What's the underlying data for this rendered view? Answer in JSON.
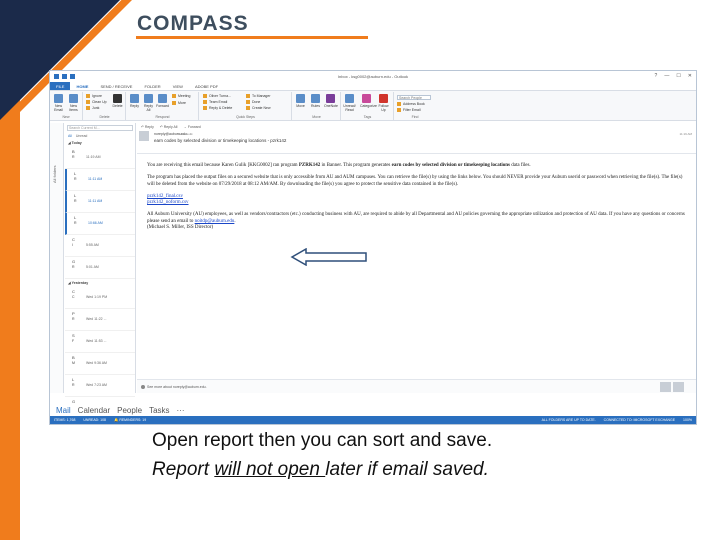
{
  "slide": {
    "logo_text": "COMPASS",
    "caption_line1": "Open report then you can sort and save.",
    "caption_line2_pre": "Report ",
    "caption_line2_underlined": "will not open ",
    "caption_line2_post": "later if email saved.",
    "colors": {
      "accent": "#f07c1c",
      "navy": "#1b2a4a",
      "outlook_blue": "#2a6fbf"
    }
  },
  "window": {
    "title": "Inbox - ksg0002@auburn.edu - Outlook",
    "controls": [
      "?",
      "—",
      "☐",
      "✕"
    ],
    "tabs": [
      "FILE",
      "HOME",
      "SEND / RECEIVE",
      "FOLDER",
      "VIEW",
      "ADOBE PDF"
    ],
    "active_tab": "HOME"
  },
  "ribbon": {
    "new": {
      "new_email": "New Email",
      "new_items": "New Items",
      "label": "New"
    },
    "delete": {
      "ignore": "Ignore",
      "clean_up": "Clean Up",
      "junk": "Junk",
      "delete": "Delete",
      "label": "Delete"
    },
    "respond": {
      "reply": "Reply",
      "reply_all": "Reply All",
      "forward": "Forward",
      "meeting": "Meeting",
      "more": "More",
      "label": "Respond"
    },
    "quick_steps": {
      "s1": "Oliver Turna...",
      "s2": "Team Email",
      "s3": "Reply & Delete",
      "s4": "To Manager",
      "s5": "Done",
      "s6": "Create New",
      "label": "Quick Steps"
    },
    "move": {
      "move": "Move",
      "rules": "Rules",
      "onenote": "OneNote",
      "label": "Move"
    },
    "tags": {
      "unread_read": "Unread/ Read",
      "categorize": "Categorize",
      "follow_up": "Follow Up",
      "label": "Tags"
    },
    "find": {
      "search_people": "Search People",
      "address_book": "Address Book",
      "filter_email": "Filter Email",
      "label": "Find"
    }
  },
  "sidebar": {
    "label": "All folders"
  },
  "message_list": {
    "search_placeholder": "Search Current M...",
    "filter_all": "All",
    "filter_unread": "Unread",
    "sort": "By Date",
    "today_label": "◢ Today",
    "yesterday_label": "◢ Yesterday",
    "today": [
      {
        "from": "B",
        "subj": "R",
        "time": "11:19 AM",
        "unread": false
      },
      {
        "from": "L",
        "subj": "R",
        "time": "11:11 AM",
        "unread": true
      },
      {
        "from": "L",
        "subj": "R",
        "time": "11:11 AM",
        "unread": true
      },
      {
        "from": "L",
        "subj": "R",
        "time": "10:66 AM",
        "unread": true
      },
      {
        "from": "C",
        "subj": "I",
        "time": "5:55 AM",
        "unread": false
      },
      {
        "from": "G",
        "subj": "R",
        "time": "5:01 AM",
        "unread": false
      }
    ],
    "yesterday": [
      {
        "from": "C",
        "subj": "C",
        "time": "Wed 1:19 PM"
      },
      {
        "from": "P",
        "subj": "R",
        "time": "Wed 11:22 ..."
      },
      {
        "from": "S",
        "subj": "F",
        "time": "Wed 11:53 ..."
      },
      {
        "from": "B",
        "subj": "M",
        "time": "Wed 9:36 AM"
      },
      {
        "from": "L",
        "subj": "R",
        "time": "Wed 7:23 AM"
      },
      {
        "from": "G",
        "subj": "R",
        "time": "Wed 5:01 AM"
      }
    ]
  },
  "reading": {
    "toolbar": [
      "↶ Reply",
      "↶ Reply All",
      "→ Forward"
    ],
    "from": "noreply@auburn.edu",
    "to": "Karen Gulik",
    "subject": "earn codes by selected division or timekeeping locations - pzrk142",
    "time": "11:19 AM",
    "para1_pre": "You are receiving this email because Karen Gulik [KKG0002] ran program ",
    "para1_prog": "PZRK142",
    "para1_mid": " in Banner. This program generates ",
    "para1_bold": "earn codes by selected division or timekeeping locations",
    "para1_post": " data files.",
    "para2": "The program has placed the output files on a secured website that is only accessible from AU and AUM campuses. You can retrieve the file(s) by using the links below. You should NEVER provide your Auburn userid or password when retrieving the file(s). The file(s) will be deleted from the website on 07/29/2018 at 08:12 AM/AM. By downloading the file(s) you agree to protect the sensitive data contained in the file(s).",
    "link1": "pzrk142_final.csv",
    "link2": "pzrk142_noform.csv",
    "para3_pre": "All Auburn University (AU) employees, as well as vendors/contractors (etc.) conducting business with AU, are required to abide by all Departmental and AU policies governing the appropriate utilization and protection of AU data. If you have any questions or concerns please send an email to ",
    "para3_link": "noitdp@auburn.edu",
    "para3_post": ".",
    "signature": "(Michael S. Miller, ISS Director)",
    "people_info": "See more about noreply@auburn.edu."
  },
  "navbar": {
    "mail": "Mail",
    "calendar": "Calendar",
    "people": "People",
    "tasks": "Tasks",
    "more": "···"
  },
  "statusbar": {
    "items": "ITEMS: 1,768",
    "unread": "UNREAD: 108",
    "reminders": "🔔 REMINDERS: 19",
    "folders": "ALL FOLDERS ARE UP TO DATE.",
    "connected": "CONNECTED TO: MICROSOFT EXCHANGE",
    "zoom": "100%"
  }
}
